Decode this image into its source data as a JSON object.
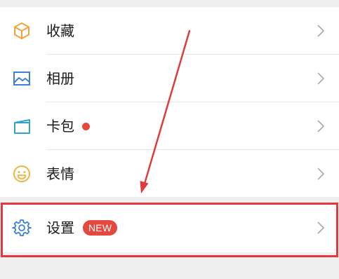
{
  "menu": {
    "items": [
      {
        "label": "收藏",
        "icon": "favorites-cube-icon",
        "icon_color": "#f2a33a"
      },
      {
        "label": "相册",
        "icon": "album-picture-icon",
        "icon_color": "#3d7fd6"
      },
      {
        "label": "卡包",
        "icon": "card-wallet-icon",
        "icon_color": "#2fa3c8",
        "has_red_dot": true
      },
      {
        "label": "表情",
        "icon": "smiley-face-icon",
        "icon_color": "#f2b33a"
      }
    ],
    "settings": {
      "label": "设置",
      "icon": "gear-icon",
      "icon_color": "#3d7fd6",
      "badge": "NEW"
    }
  },
  "annotation": {
    "highlight_color": "#e03a3e",
    "arrow_color": "#e03a3e"
  },
  "colors": {
    "background": "#efefef",
    "card": "#ffffff",
    "text": "#1a1a1a",
    "chevron": "#a9a9a9",
    "badge": "#e5483d"
  }
}
